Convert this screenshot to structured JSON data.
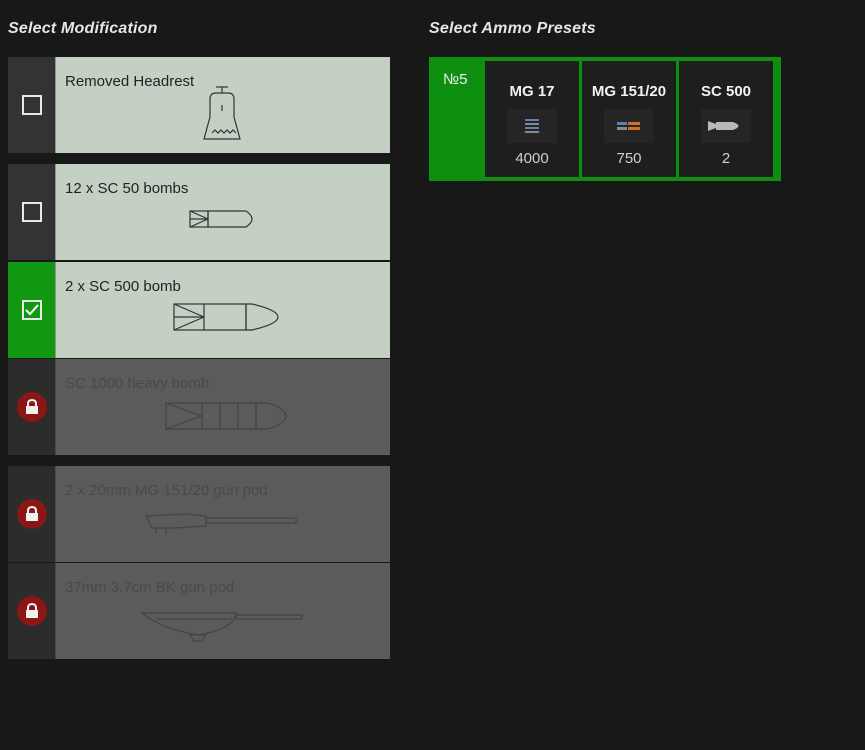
{
  "titles": {
    "modification": "Select Modification",
    "ammo": "Select Ammo Presets"
  },
  "modifications": [
    {
      "name": "Removed Headrest",
      "state": "unchecked",
      "icon": "headrest-icon"
    },
    {
      "name": "12 x SC 50 bombs",
      "state": "unchecked",
      "icon": "bomb-small-icon"
    },
    {
      "name": "2 x SC 500 bomb",
      "state": "checked",
      "icon": "bomb-medium-icon"
    },
    {
      "name": "SC 1000 heavy bomb",
      "state": "locked",
      "icon": "bomb-heavy-icon"
    },
    {
      "name": "2 x 20mm MG 151/20 gun pod",
      "state": "locked",
      "icon": "gun-pod-icon"
    },
    {
      "name": "37mm 3.7cm BK gun pod",
      "state": "locked",
      "icon": "cannon-pod-icon"
    }
  ],
  "preset": {
    "number": "№5",
    "ammo": [
      {
        "name": "MG 17",
        "count": "4000",
        "icon": "mg-belt-icon"
      },
      {
        "name": "MG 151/20",
        "count": "750",
        "icon": "cannon-shell-icon"
      },
      {
        "name": "SC 500",
        "count": "2",
        "icon": "bomb-icon"
      }
    ]
  },
  "colors": {
    "selected_green": "#119711",
    "preset_green": "#0f8f0f",
    "lock_red": "#8a1616",
    "row_light": "#c5d0c5",
    "row_locked": "#5b5b5b"
  }
}
